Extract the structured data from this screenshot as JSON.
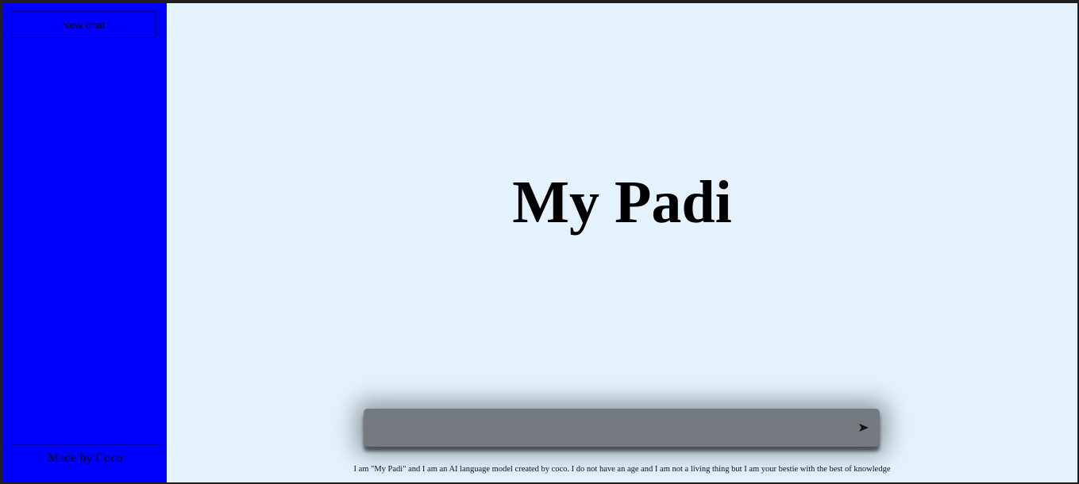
{
  "sidebar": {
    "new_chat_label": "New chat",
    "footer_text": "Made by Coco",
    "background_color": "#0000ff"
  },
  "main": {
    "title": "My Padi",
    "background_color": "#e3f2fd",
    "input": {
      "value": "",
      "placeholder": ""
    },
    "send_icon": "send-arrow-icon",
    "disclaimer": "I am \"My Padi\" and I am an AI language model created by coco. I do not have an age and I am not a living thing but I am your bestie with the best of knowledge"
  }
}
